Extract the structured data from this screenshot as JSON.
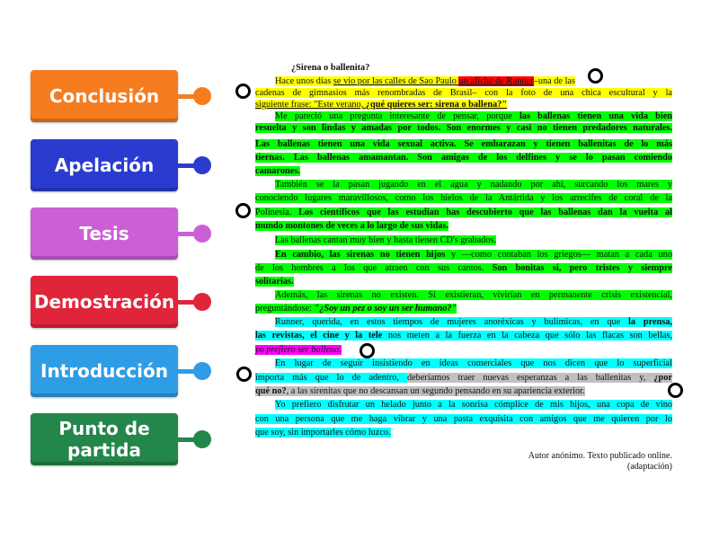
{
  "labels": [
    {
      "text": "Conclusión",
      "color": "#f57c1f"
    },
    {
      "text": "Apelación",
      "color": "#2a3ccf"
    },
    {
      "text": "Tesis",
      "color": "#cc5fd6"
    },
    {
      "text": "Demostración",
      "color": "#e0243a"
    },
    {
      "text": "Introducción",
      "color": "#2e9de6"
    },
    {
      "text": "Punto de partida",
      "color": "#23864a"
    }
  ],
  "document": {
    "title": "¿Sirena o ballenita?",
    "lines": [
      {
        "ind": 1,
        "j": 0,
        "s": [
          {
            "t": "Hace unos días ",
            "hl": "yellow"
          },
          {
            "t": "se vio por las calles de Sao Paulo ",
            "hl": "yellow",
            "u": 1
          },
          {
            "t": "un afiche de Runner",
            "hl": "red",
            "u": 1
          },
          {
            "t": "–una de las",
            "hl": "yellow"
          }
        ]
      },
      {
        "ind": 0,
        "j": 1,
        "s": [
          {
            "t": "cadenas de gimnasios más renombradas de Brasil– con la foto de una chica escultural y la",
            "hl": "yellow"
          }
        ]
      },
      {
        "ind": 0,
        "j": 0,
        "s": [
          {
            "t": "siguiente frase: \"Este verano, ",
            "hl": "yellow",
            "u": 1
          },
          {
            "t": "¿qué quieres ser: sirena o ballena?\"",
            "hl": "yellow",
            "u": 1,
            "b": 1
          }
        ]
      },
      {
        "ind": 1,
        "j": 1,
        "s": [
          {
            "t": "Me pareció una pregunta interesante de pensar, porque ",
            "hl": "green"
          },
          {
            "t": "las ballenas tienen una vida bien",
            "hl": "green",
            "b": 1
          }
        ]
      },
      {
        "ind": 0,
        "j": 1,
        "s": [
          {
            "t": "resuelta y son lindas y amadas por todos. Son enormes y casi no tienen predadores naturales.",
            "hl": "green",
            "b": 1
          }
        ]
      },
      {
        "ind": 0,
        "j": 1,
        "s": [
          {
            "t": "Las ballenas tienen una vida sexual activa. Se embarazan y tienen ballenitas de lo más",
            "hl": "green",
            "b": 1
          }
        ]
      },
      {
        "ind": 0,
        "j": 1,
        "s": [
          {
            "t": "tiernas. Las ballenas amamantan. Son amigas de los delfines y se lo pasan comiendo",
            "hl": "green",
            "b": 1
          }
        ]
      },
      {
        "ind": 0,
        "j": 0,
        "s": [
          {
            "t": "camarones.",
            "hl": "green",
            "b": 1
          }
        ]
      },
      {
        "ind": 1,
        "j": 1,
        "s": [
          {
            "t": "También se la pasan jugando en el agua y nadando por ahí, surcando los mares y",
            "hl": "green"
          }
        ]
      },
      {
        "ind": 0,
        "j": 1,
        "s": [
          {
            "t": "conociendo lugares maravillosos, como los hielos de la Antártida y los arrecifes de coral de la",
            "hl": "green"
          }
        ]
      },
      {
        "ind": 0,
        "j": 1,
        "s": [
          {
            "t": "Polinesia. ",
            "hl": "green"
          },
          {
            "t": "Los científicos que las estudian has descubierto que las ballenas dan la vuelta al",
            "hl": "green",
            "b": 1
          }
        ]
      },
      {
        "ind": 0,
        "j": 0,
        "s": [
          {
            "t": "mundo montones de veces a lo largo de sus vidas.",
            "hl": "green",
            "b": 1
          }
        ]
      },
      {
        "ind": 1,
        "j": 0,
        "s": [
          {
            "t": "Las ballenas cantan muy bien y hasta tienen CD's grabados.",
            "hl": "green"
          }
        ]
      },
      {
        "ind": 1,
        "j": 1,
        "s": [
          {
            "t": "En cambio, las sirenas no tienen hijos",
            "hl": "green",
            "b": 1
          },
          {
            "t": " y —como contaban los griegos— matan a cada uno",
            "hl": "green"
          }
        ]
      },
      {
        "ind": 0,
        "j": 1,
        "s": [
          {
            "t": "de los hombres a los que atraen con sus cantos. ",
            "hl": "green"
          },
          {
            "t": "Son bonitas sí, pero tristes y siempre",
            "hl": "green",
            "b": 1
          }
        ]
      },
      {
        "ind": 0,
        "j": 0,
        "s": [
          {
            "t": "solitarias.",
            "hl": "green",
            "b": 1
          }
        ]
      },
      {
        "ind": 1,
        "j": 1,
        "s": [
          {
            "t": "Además, las sirenas no existen. Si existieran, vivirían en permanente crisis existencial,",
            "hl": "green"
          }
        ]
      },
      {
        "ind": 0,
        "j": 0,
        "s": [
          {
            "t": "preguntándose: ",
            "hl": "green"
          },
          {
            "t": "\"¿Soy un pez o soy un ser humano?\"",
            "hl": "green",
            "b": 1,
            "i": 1
          }
        ]
      },
      {
        "ind": 1,
        "j": 1,
        "s": [
          {
            "t": "Runner, querida, en estos tiempos de mujeres anoréxicas y bulímicas, en que ",
            "hl": "cyan"
          },
          {
            "t": "la prensa,",
            "hl": "cyan",
            "b": 1
          }
        ]
      },
      {
        "ind": 0,
        "j": 1,
        "s": [
          {
            "t": "las revistas, el cine y la tele",
            "hl": "cyan",
            "b": 1
          },
          {
            "t": " nos meten a la fuerza en la cabeza que sólo las flacas son bellas,",
            "hl": "cyan"
          }
        ]
      },
      {
        "ind": 0,
        "j": 0,
        "s": [
          {
            "t": "yo prefiero ser ballena.",
            "hl": "magenta",
            "i": 1
          }
        ]
      },
      {
        "ind": 1,
        "j": 1,
        "s": [
          {
            "t": "En lugar de seguir insistiendo en ideas comerciales que nos dicen que lo superficial",
            "hl": "cyan"
          }
        ]
      },
      {
        "ind": 0,
        "j": 1,
        "s": [
          {
            "t": "importa más que lo de adentro, ",
            "hl": "cyan"
          },
          {
            "t": "deberíamos traer nuevas esperanzas a las ballenitas y, ",
            "hl": "gray"
          },
          {
            "t": "¿por",
            "hl": "gray",
            "b": 1
          }
        ]
      },
      {
        "ind": 0,
        "j": 0,
        "s": [
          {
            "t": "qué no?",
            "hl": "gray",
            "b": 1
          },
          {
            "t": ", a las sirenitas que no descansan un segundo pensando en su apariencia exterior.",
            "hl": "gray"
          }
        ]
      },
      {
        "ind": 1,
        "j": 1,
        "s": [
          {
            "t": "Yo prefiero disfrutar un helado junto a la sonrisa cómplice de mis hijos, una copa de vino",
            "hl": "cyan"
          }
        ]
      },
      {
        "ind": 0,
        "j": 1,
        "s": [
          {
            "t": "con una persona que me haga vibrar y una pasta exquisita con amigos que me quieren por lo",
            "hl": "cyan"
          }
        ]
      },
      {
        "ind": 0,
        "j": 0,
        "s": [
          {
            "t": "que soy, sin importarles cómo luzco.",
            "hl": "cyan"
          }
        ]
      }
    ],
    "source_line1": "Autor anónimo. Texto publicado online.",
    "source_line2": "(adaptación)"
  }
}
